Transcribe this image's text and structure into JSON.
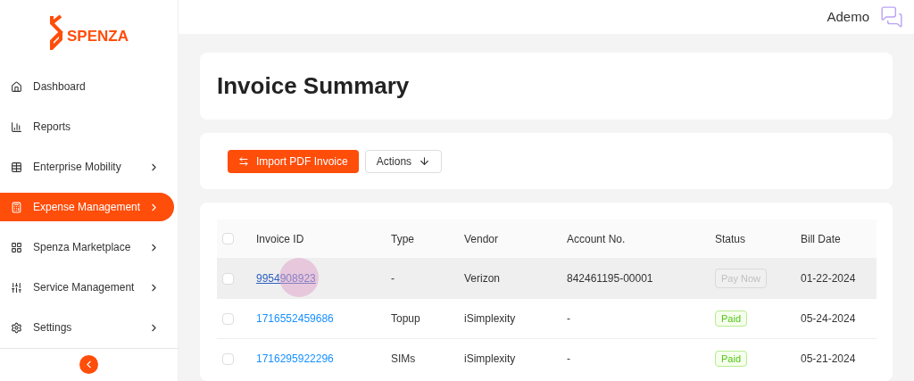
{
  "brand": {
    "name": "SPENZA"
  },
  "header": {
    "user": "Ademo"
  },
  "sidebar": {
    "items": [
      {
        "label": "Dashboard",
        "submenu": false,
        "selected": false
      },
      {
        "label": "Reports",
        "submenu": false,
        "selected": false
      },
      {
        "label": "Enterprise Mobility",
        "submenu": true,
        "selected": false
      },
      {
        "label": "Expense Management",
        "submenu": true,
        "selected": true
      },
      {
        "label": "Spenza Marketplace",
        "submenu": true,
        "selected": false
      },
      {
        "label": "Service Management",
        "submenu": true,
        "selected": false
      },
      {
        "label": "Settings",
        "submenu": true,
        "selected": false
      }
    ]
  },
  "page": {
    "title": "Invoice Summary"
  },
  "toolbar": {
    "import_button": "Import PDF Invoice",
    "actions_button": "Actions"
  },
  "table": {
    "select_all_checked": false,
    "columns": [
      "Invoice ID",
      "Type",
      "Vendor",
      "Account No.",
      "Status",
      "Bill Date"
    ],
    "rows": [
      {
        "invoice_id": "9954908923",
        "type": "-",
        "vendor": "Verizon",
        "account": "842461195-00001",
        "status": {
          "kind": "pay_now",
          "text": "Pay Now"
        },
        "bill_date": "01-22-2024",
        "checked": false,
        "highlighted": true,
        "clicked": true
      },
      {
        "invoice_id": "1716552459686",
        "type": "Topup",
        "vendor": "iSimplexity",
        "account": "-",
        "status": {
          "kind": "paid",
          "text": "Paid"
        },
        "bill_date": "05-24-2024",
        "checked": false,
        "highlighted": false,
        "clicked": false
      },
      {
        "invoice_id": "1716295922296",
        "type": "SIMs",
        "vendor": "iSimplexity",
        "account": "-",
        "status": {
          "kind": "paid",
          "text": "Paid"
        },
        "bill_date": "05-21-2024",
        "checked": false,
        "highlighted": false,
        "clicked": false
      }
    ]
  }
}
